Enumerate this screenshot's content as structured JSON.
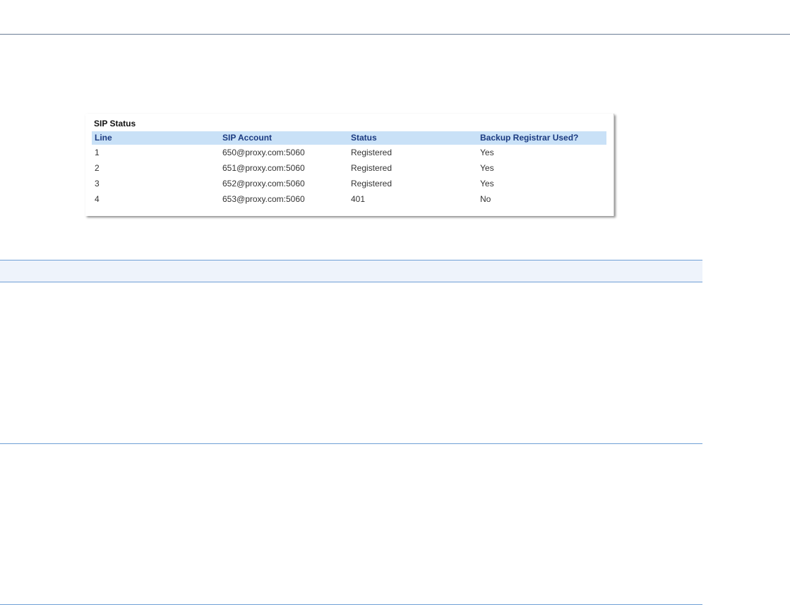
{
  "sip_status": {
    "title": "SIP Status",
    "columns": [
      "Line",
      "SIP Account",
      "Status",
      "Backup Registrar Used?"
    ],
    "rows": [
      {
        "line": "1",
        "account": "650@proxy.com:5060",
        "status": "Registered",
        "backup": "Yes"
      },
      {
        "line": "2",
        "account": "651@proxy.com:5060",
        "status": "Registered",
        "backup": "Yes"
      },
      {
        "line": "3",
        "account": "652@proxy.com:5060",
        "status": "Registered",
        "backup": "Yes"
      },
      {
        "line": "4",
        "account": "653@proxy.com:5060",
        "status": "401",
        "backup": "No"
      }
    ]
  },
  "colors": {
    "header_bg": "#c9e1f7",
    "header_text": "#1b3a80",
    "rule_blue": "#6f9fd6",
    "band_bg": "#eef3fb"
  }
}
